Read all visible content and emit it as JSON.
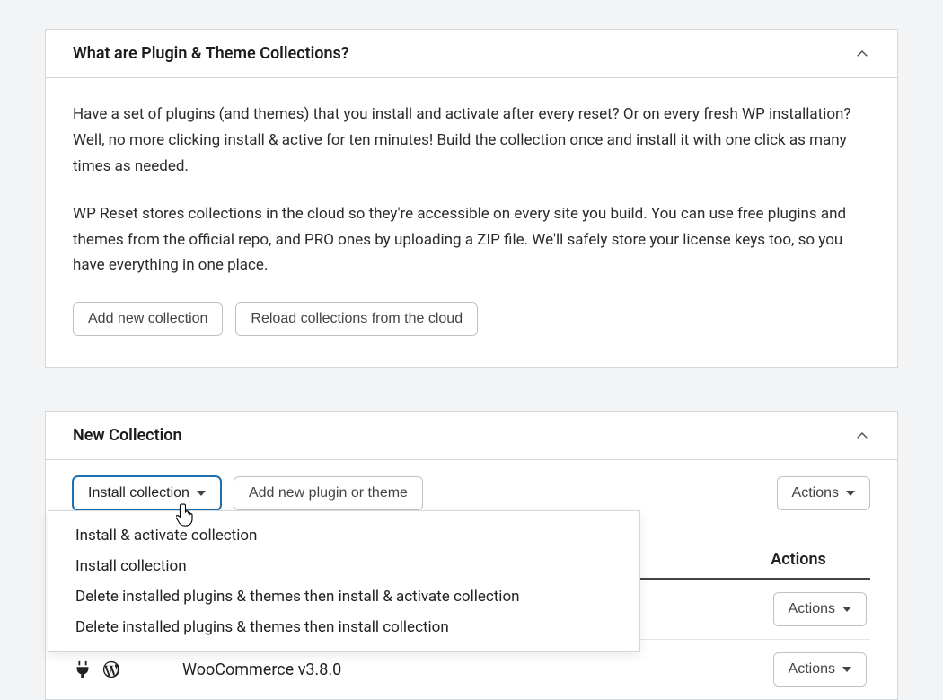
{
  "panel1": {
    "title": "What are Plugin & Theme Collections?",
    "p1": "Have a set of plugins (and themes) that you install and activate after every reset? Or on every fresh WP installation? Well, no more clicking install & active for ten minutes! Build the collection once and install it with one click as many times as needed.",
    "p2": "WP Reset stores collections in the cloud so they're accessible on every site you build. You can use free plugins and themes from the official repo, and PRO ones by uploading a ZIP file. We'll safely store your license keys too, so you have everything in one place.",
    "btn_add": "Add new collection",
    "btn_reload": "Reload collections from the cloud"
  },
  "panel2": {
    "title": "New Collection",
    "btn_install": "Install collection",
    "btn_add_item": "Add new plugin or theme",
    "btn_actions": "Actions",
    "menu": {
      "m1": "Install & activate collection",
      "m2": "Install collection",
      "m3": "Delete installed plugins & themes then install & activate collection",
      "m4": "Delete installed plugins & themes then install collection"
    },
    "table": {
      "col_actions": "Actions",
      "row1_name": "WooCommerce v3.8.0",
      "row_actions": "Actions"
    }
  }
}
